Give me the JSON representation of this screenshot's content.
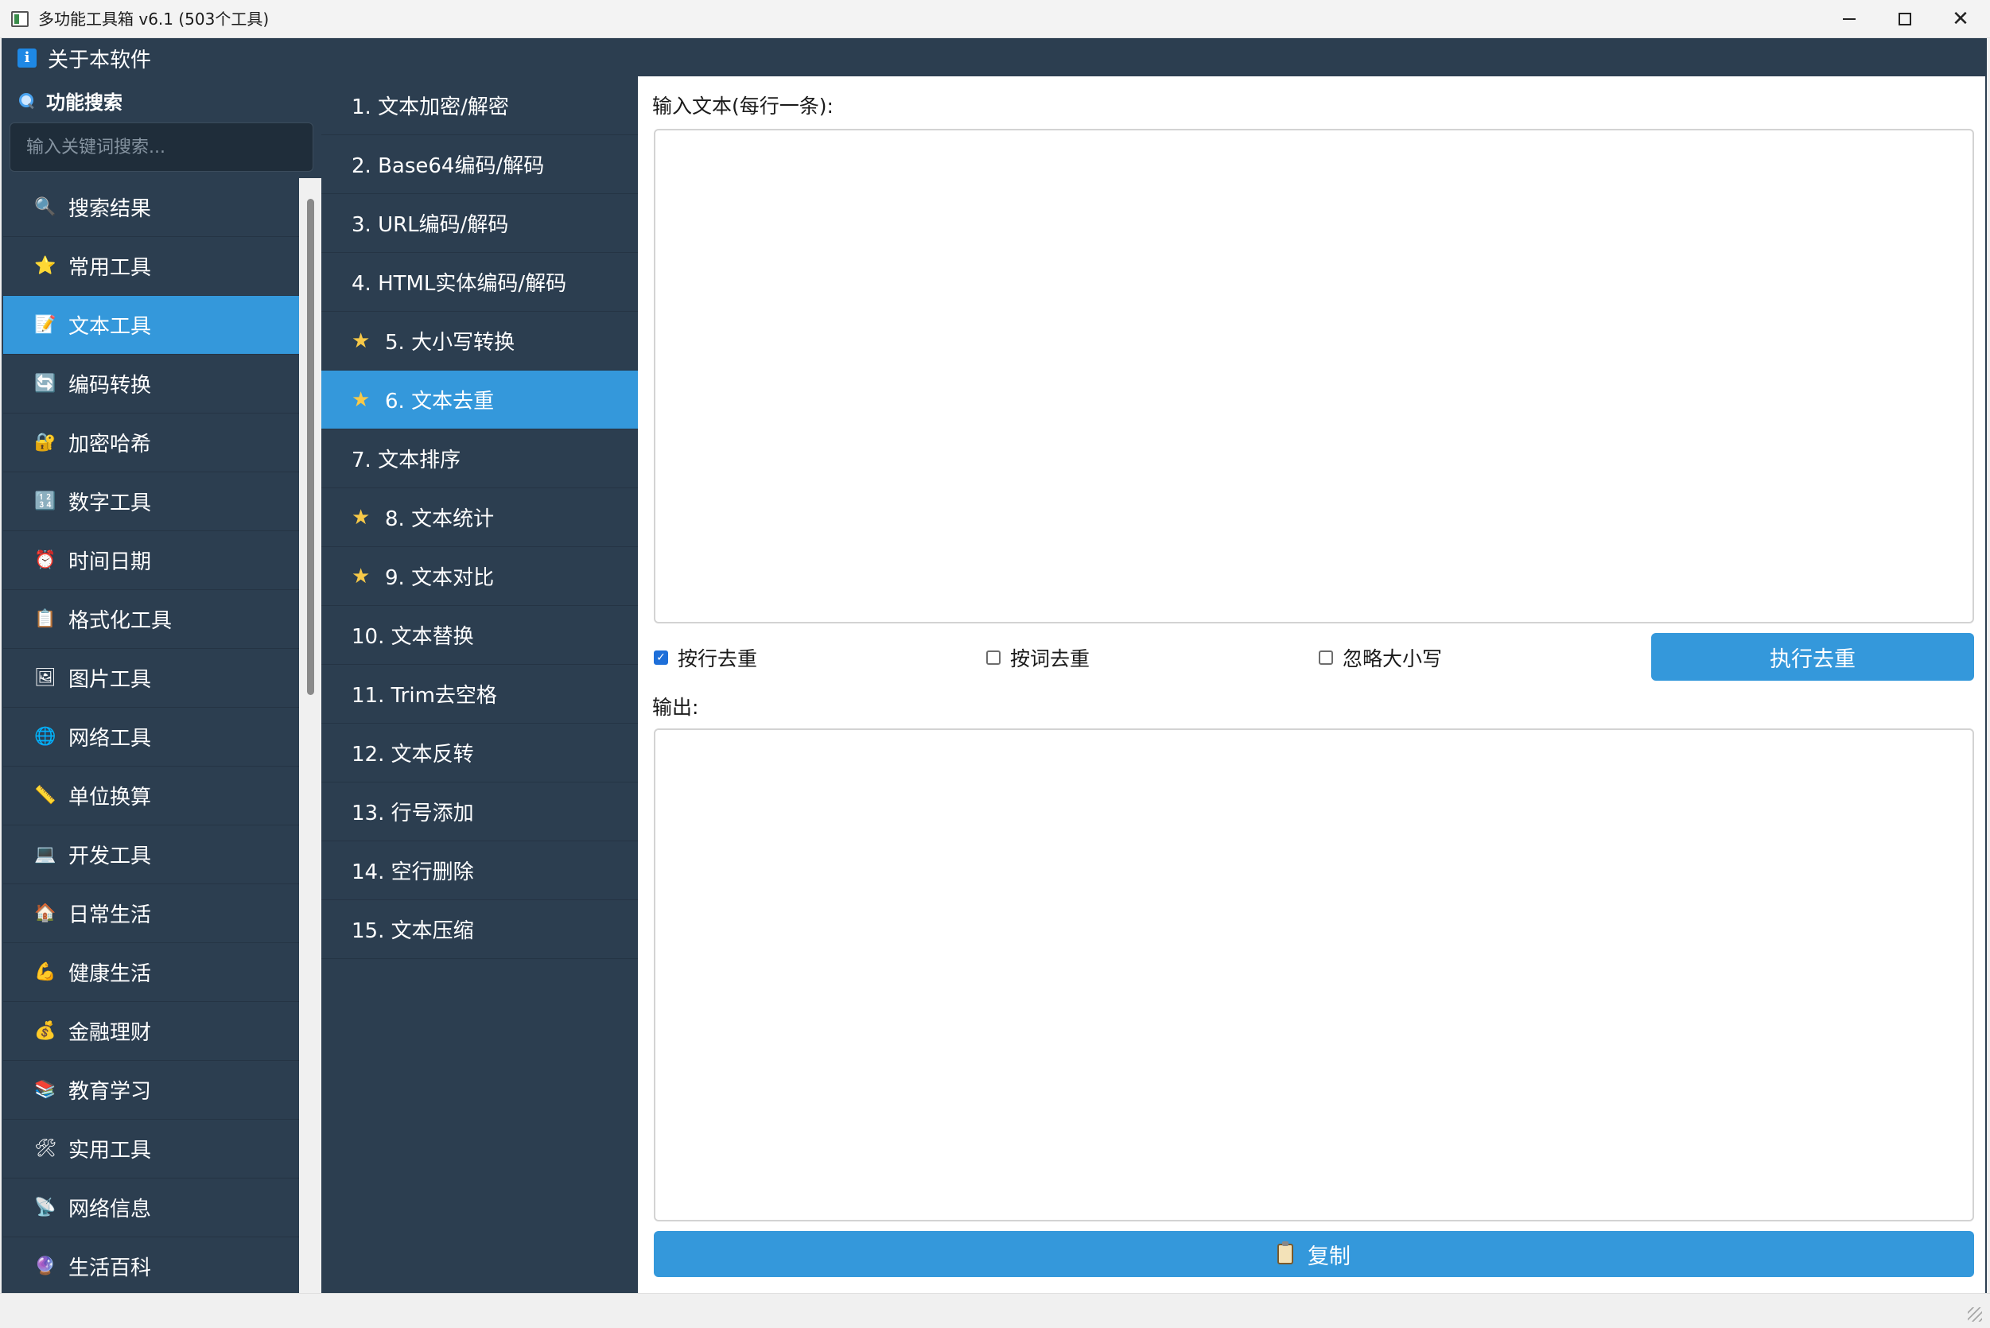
{
  "window": {
    "title": "多功能工具箱 v6.1 (503个工具)",
    "controls": {
      "minimize": "minimize-icon",
      "maximize": "maximize-icon",
      "close": "✕"
    }
  },
  "menu": {
    "about_label": "关于本软件",
    "about_icon": "i"
  },
  "search": {
    "title": "功能搜索",
    "placeholder": "输入关键词搜索..."
  },
  "categories": [
    {
      "label": "搜索结果",
      "icon": "search-icon",
      "glyph": "🔍",
      "active": false
    },
    {
      "label": "常用工具",
      "icon": "star-icon",
      "glyph": "⭐",
      "active": false
    },
    {
      "label": "文本工具",
      "icon": "memo-icon",
      "glyph": "📝",
      "active": true
    },
    {
      "label": "编码转换",
      "icon": "convert-icon",
      "glyph": "🔄",
      "active": false
    },
    {
      "label": "加密哈希",
      "icon": "lock-icon",
      "glyph": "🔐",
      "active": false
    },
    {
      "label": "数字工具",
      "icon": "numbers-icon",
      "glyph": "🔢",
      "active": false
    },
    {
      "label": "时间日期",
      "icon": "alarm-clock-icon",
      "glyph": "⏰",
      "active": false
    },
    {
      "label": "格式化工具",
      "icon": "clipboard-icon",
      "glyph": "📋",
      "active": false
    },
    {
      "label": "图片工具",
      "icon": "picture-icon",
      "glyph": "🖼",
      "active": false
    },
    {
      "label": "网络工具",
      "icon": "globe-icon",
      "glyph": "🌐",
      "active": false
    },
    {
      "label": "单位换算",
      "icon": "ruler-icon",
      "glyph": "📏",
      "active": false
    },
    {
      "label": "开发工具",
      "icon": "laptop-icon",
      "glyph": "💻",
      "active": false
    },
    {
      "label": "日常生活",
      "icon": "house-icon",
      "glyph": "🏠",
      "active": false
    },
    {
      "label": "健康生活",
      "icon": "muscle-icon",
      "glyph": "💪",
      "active": false
    },
    {
      "label": "金融理财",
      "icon": "money-bag-icon",
      "glyph": "💰",
      "active": false
    },
    {
      "label": "教育学习",
      "icon": "books-icon",
      "glyph": "📚",
      "active": false
    },
    {
      "label": "实用工具",
      "icon": "tools-icon",
      "glyph": "🛠",
      "active": false
    },
    {
      "label": "网络信息",
      "icon": "satellite-icon",
      "glyph": "📡",
      "active": false
    },
    {
      "label": "生活百科",
      "icon": "disc-icon",
      "glyph": "🔮",
      "active": false
    }
  ],
  "tools": [
    {
      "label": "1. 文本加密/解密",
      "starred": false,
      "active": false
    },
    {
      "label": "2. Base64编码/解码",
      "starred": false,
      "active": false
    },
    {
      "label": "3. URL编码/解码",
      "starred": false,
      "active": false
    },
    {
      "label": "4. HTML实体编码/解码",
      "starred": false,
      "active": false
    },
    {
      "label": "5. 大小写转换",
      "starred": true,
      "active": false
    },
    {
      "label": "6. 文本去重",
      "starred": true,
      "active": true
    },
    {
      "label": "7. 文本排序",
      "starred": false,
      "active": false
    },
    {
      "label": "8. 文本统计",
      "starred": true,
      "active": false
    },
    {
      "label": "9. 文本对比",
      "starred": true,
      "active": false
    },
    {
      "label": "10. 文本替换",
      "starred": false,
      "active": false
    },
    {
      "label": "11. Trim去空格",
      "starred": false,
      "active": false
    },
    {
      "label": "12. 文本反转",
      "starred": false,
      "active": false
    },
    {
      "label": "13. 行号添加",
      "starred": false,
      "active": false
    },
    {
      "label": "14. 空行删除",
      "starred": false,
      "active": false
    },
    {
      "label": "15. 文本压缩",
      "starred": false,
      "active": false
    }
  ],
  "tool_panel": {
    "input_label": "输入文本(每行一条):",
    "input_value": "",
    "options": [
      {
        "label": "按行去重",
        "checked": true
      },
      {
        "label": "按词去重",
        "checked": false
      },
      {
        "label": "忽略大小写",
        "checked": false
      }
    ],
    "run_label": "执行去重",
    "output_label": "输出:",
    "output_value": "",
    "copy_label": "复制"
  },
  "colors": {
    "sidebar_bg": "#2c3e50",
    "accent": "#3498db",
    "star": "#f7c948"
  }
}
